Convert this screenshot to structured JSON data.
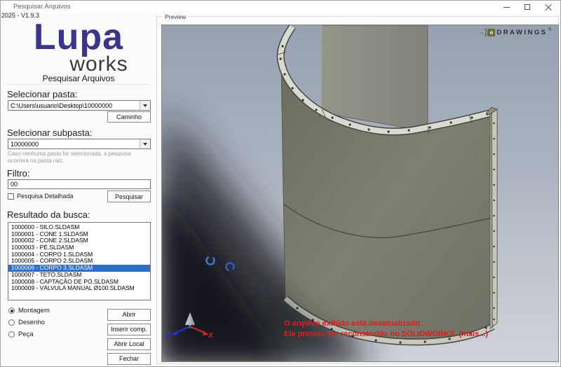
{
  "window": {
    "title": "Pesquisar Arquivos",
    "version": "2025 - V1.9.3",
    "controls": [
      "minimize-icon",
      "maximize-icon",
      "close-icon"
    ]
  },
  "logo": {
    "line1": "Lupa",
    "line2": "works",
    "subtitle": "Pesquisar Arquivos"
  },
  "folder": {
    "label": "Selecionar pasta:",
    "value": "C:\\Users\\usuario\\Desktop\\10000000",
    "button": "Caminho"
  },
  "subfolder": {
    "label": "Selecionar subpasta:",
    "value": "10000000",
    "hint": "Caso nenhuma pasta for selecionada, a pesquisa ocorrerá na pasta raiz."
  },
  "filter": {
    "label": "Filtro:",
    "value": "00",
    "checkbox_label": "Pesquisa Detalhada",
    "checkbox_checked": false,
    "search_button": "Pesquisar"
  },
  "results": {
    "label": "Resultado da busca:",
    "selected_index": 6,
    "items": [
      "1000000 - SILO.SLDASM",
      "1000001 - CONE 1.SLDASM",
      "1000002 - CONE 2.SLDASM",
      "1000003 - PÉ.SLDASM",
      "1000004 - CORPO 1.SLDASM",
      "1000005 - CORPO 2.SLDASM",
      "1000006 - CORPO 3.SLDASM",
      "1000007 - TETO.SLDASM",
      "1000008 - CAPTAÇÃO DE PÓ.SLDASM",
      "1000009 - VÁLVULA MANUAL Ø100.SLDASM"
    ]
  },
  "type_options": [
    {
      "label": "Montagem",
      "selected": true,
      "name": "radio-montagem"
    },
    {
      "label": "Desenho",
      "selected": false,
      "name": "radio-desenho"
    },
    {
      "label": "Peça",
      "selected": false,
      "name": "radio-peca"
    }
  ],
  "actions": [
    {
      "label": "Abrir",
      "name": "open-button"
    },
    {
      "label": "Inserir comp.",
      "name": "insert-component-button"
    },
    {
      "label": "Abrir Local",
      "name": "open-location-button"
    },
    {
      "label": "Fechar",
      "name": "close-dialog-button"
    }
  ],
  "preview": {
    "label": "Preview",
    "brand": {
      "arrow": "→]",
      "e": "e",
      "name": "DRAWINGS",
      "reg": "®"
    },
    "warning_line1": "O arquivo exibido está desatualizado.",
    "warning_line2": "Ele precisa ser reconstruído no SOLIDWORKS. (mais...)",
    "triad": {
      "x": "X",
      "z": "Z"
    }
  },
  "colors": {
    "brand_purple": "#3c3589",
    "selection_blue": "#2f6ec4",
    "warning_red": "#e01c1c",
    "viewport_top": "#96a1b2",
    "viewport_bottom": "#cdd1d7",
    "model_gray": "#7b7b6e",
    "edrawings_olive": "#6b6b33"
  }
}
